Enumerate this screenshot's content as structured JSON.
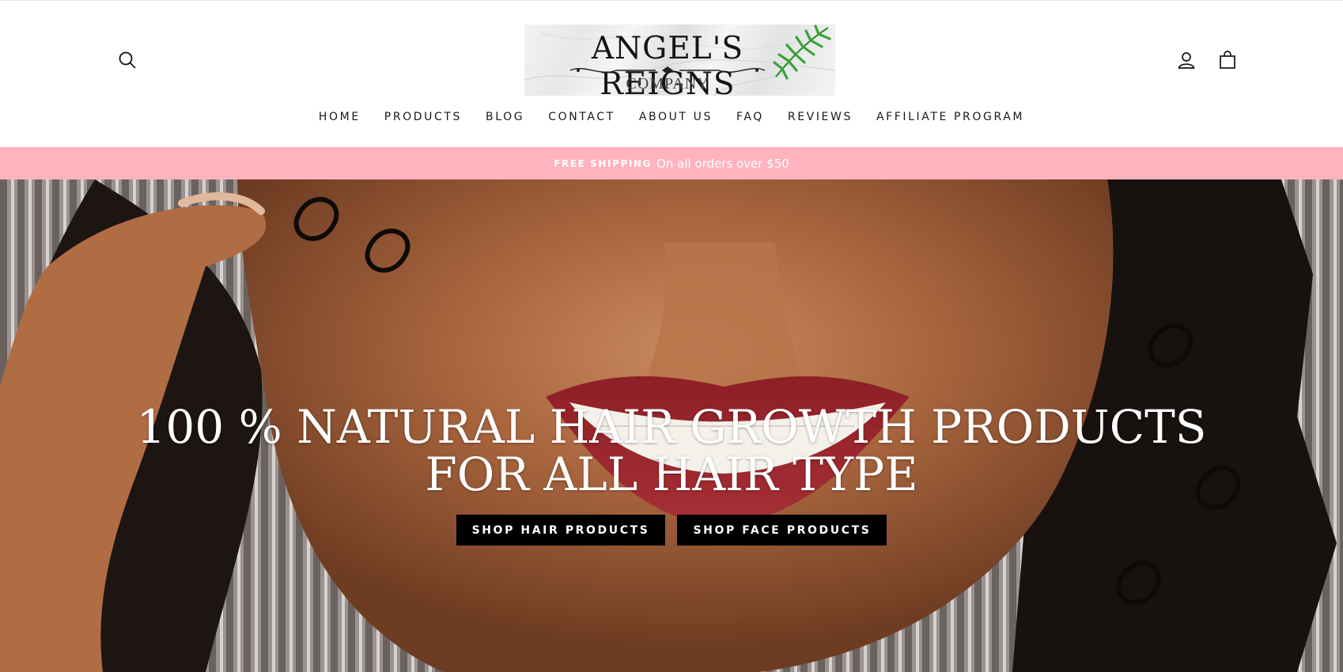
{
  "header": {
    "logo": {
      "title": "ANGEL'S REIGNS",
      "subtitle": "COMPANY",
      "icon": "palm-leaf-logo"
    },
    "icons": {
      "search": "search-icon",
      "account": "user-account-icon",
      "cart": "shopping-bag-icon"
    },
    "nav": [
      {
        "label": "HOME"
      },
      {
        "label": "PRODUCTS"
      },
      {
        "label": "BLOG"
      },
      {
        "label": "CONTACT"
      },
      {
        "label": "ABOUT US"
      },
      {
        "label": "FAQ"
      },
      {
        "label": "REVIEWS"
      },
      {
        "label": "AFFILIATE PROGRAM"
      }
    ]
  },
  "announcement": {
    "strong": "FREE SHIPPING",
    "text": "On all orders over $50",
    "bg_color": "#feb3bf"
  },
  "hero": {
    "title_line1": "100 % NATURAL HAIR GROWTH PRODUCTS",
    "title_line2": "FOR ALL HAIR TYPE",
    "buttons": [
      {
        "label": "SHOP HAIR PRODUCTS"
      },
      {
        "label": "SHOP FACE PRODUCTS"
      }
    ]
  }
}
